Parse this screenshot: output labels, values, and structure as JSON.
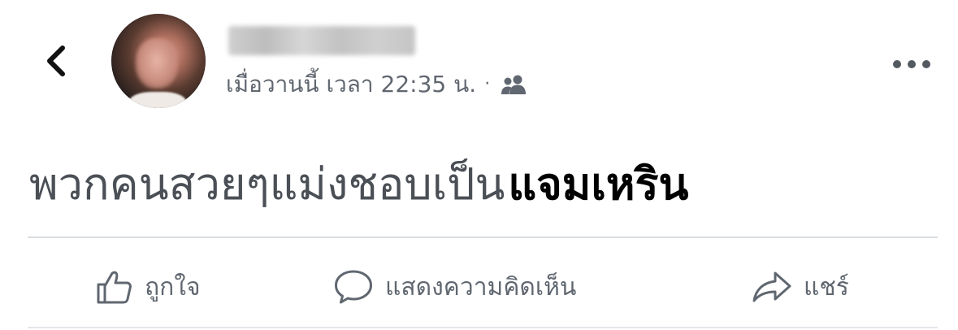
{
  "post": {
    "author_name": "",
    "timestamp": "เมื่อวานนี้ เวลา 22:35 น.",
    "separator": "·",
    "audience_icon": "friends-icon",
    "text_part1": "พวกคนสวยๆแม่งชอบเป็น",
    "text_part2": "แจมเหริน"
  },
  "actions": {
    "like_label": "ถูกใจ",
    "comment_label": "แสดงความคิดเห็น",
    "share_label": "แชร์"
  },
  "icons": {
    "back": "chevron-left-icon",
    "more": "more-horizontal-icon",
    "like": "thumbs-up-icon",
    "comment": "comment-bubble-icon",
    "share": "share-arrow-icon"
  },
  "colors": {
    "meta_text": "#616770",
    "action_text": "#606770",
    "divider": "#dadde1"
  }
}
